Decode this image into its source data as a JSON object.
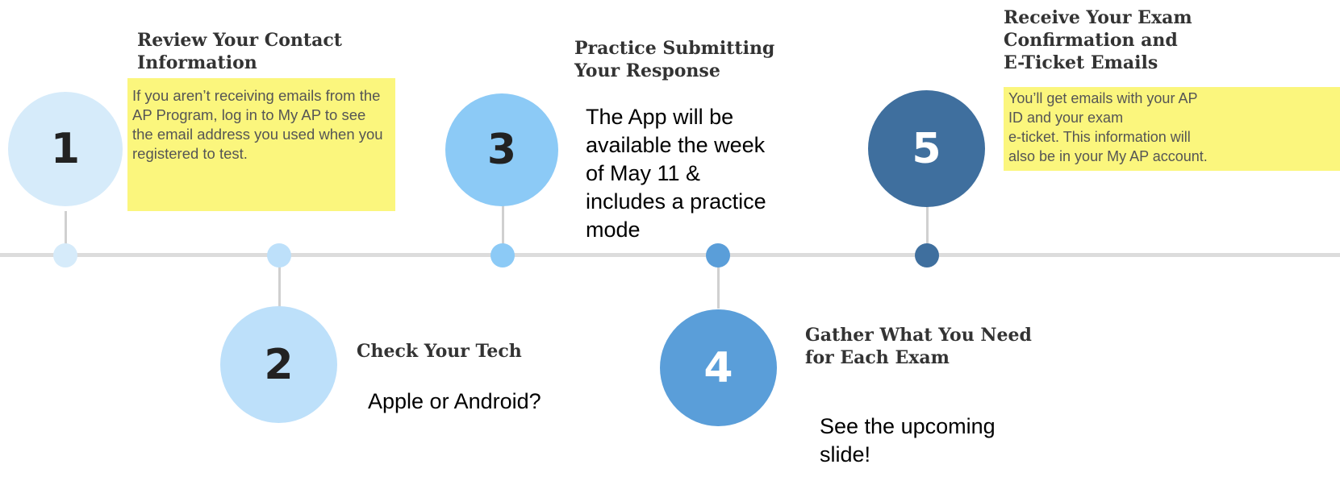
{
  "steps": [
    {
      "number": "1",
      "title_line1": "Review Your Contact",
      "title_line2": "Information",
      "description": "If you aren’t receiving emails from the AP Program, log in to My AP to see the email address you used when you registered to test.",
      "circle_color": "#d6ebfa",
      "dot_color": "#d6ebfa",
      "number_color": "#222222"
    },
    {
      "number": "2",
      "title_line1": "Check Your Tech",
      "note": "Apple or Android?",
      "circle_color": "#bde0fa",
      "dot_color": "#bde0fa",
      "number_color": "#222222"
    },
    {
      "number": "3",
      "title_line1": "Practice Submitting",
      "title_line2": "Your Response",
      "note_lines": [
        "The App will be",
        "available the week",
        "of May 11 &",
        "includes a practice",
        "mode"
      ],
      "circle_color": "#8ccaf6",
      "dot_color": "#8ccaf6",
      "number_color": "#222222"
    },
    {
      "number": "4",
      "title_line1": "Gather What You Need",
      "title_line2": "for Each Exam",
      "note_lines": [
        "See the upcoming",
        "slide!"
      ],
      "circle_color": "#5a9ed9",
      "dot_color": "#5a9ed9",
      "number_color": "#ffffff"
    },
    {
      "number": "5",
      "title_line1": "Receive Your Exam",
      "title_line2": "Confirmation and",
      "title_line3": "E-Ticket Emails",
      "description_lines": [
        "You’ll get emails with your AP",
        "ID and your exam",
        "e-ticket. This information will",
        "also be in your My AP account."
      ],
      "circle_color": "#3f6f9e",
      "dot_color": "#3f6f9e",
      "number_color": "#ffffff"
    }
  ],
  "colors": {
    "line": "#dcdcdc",
    "highlight": "#fbf67d"
  }
}
